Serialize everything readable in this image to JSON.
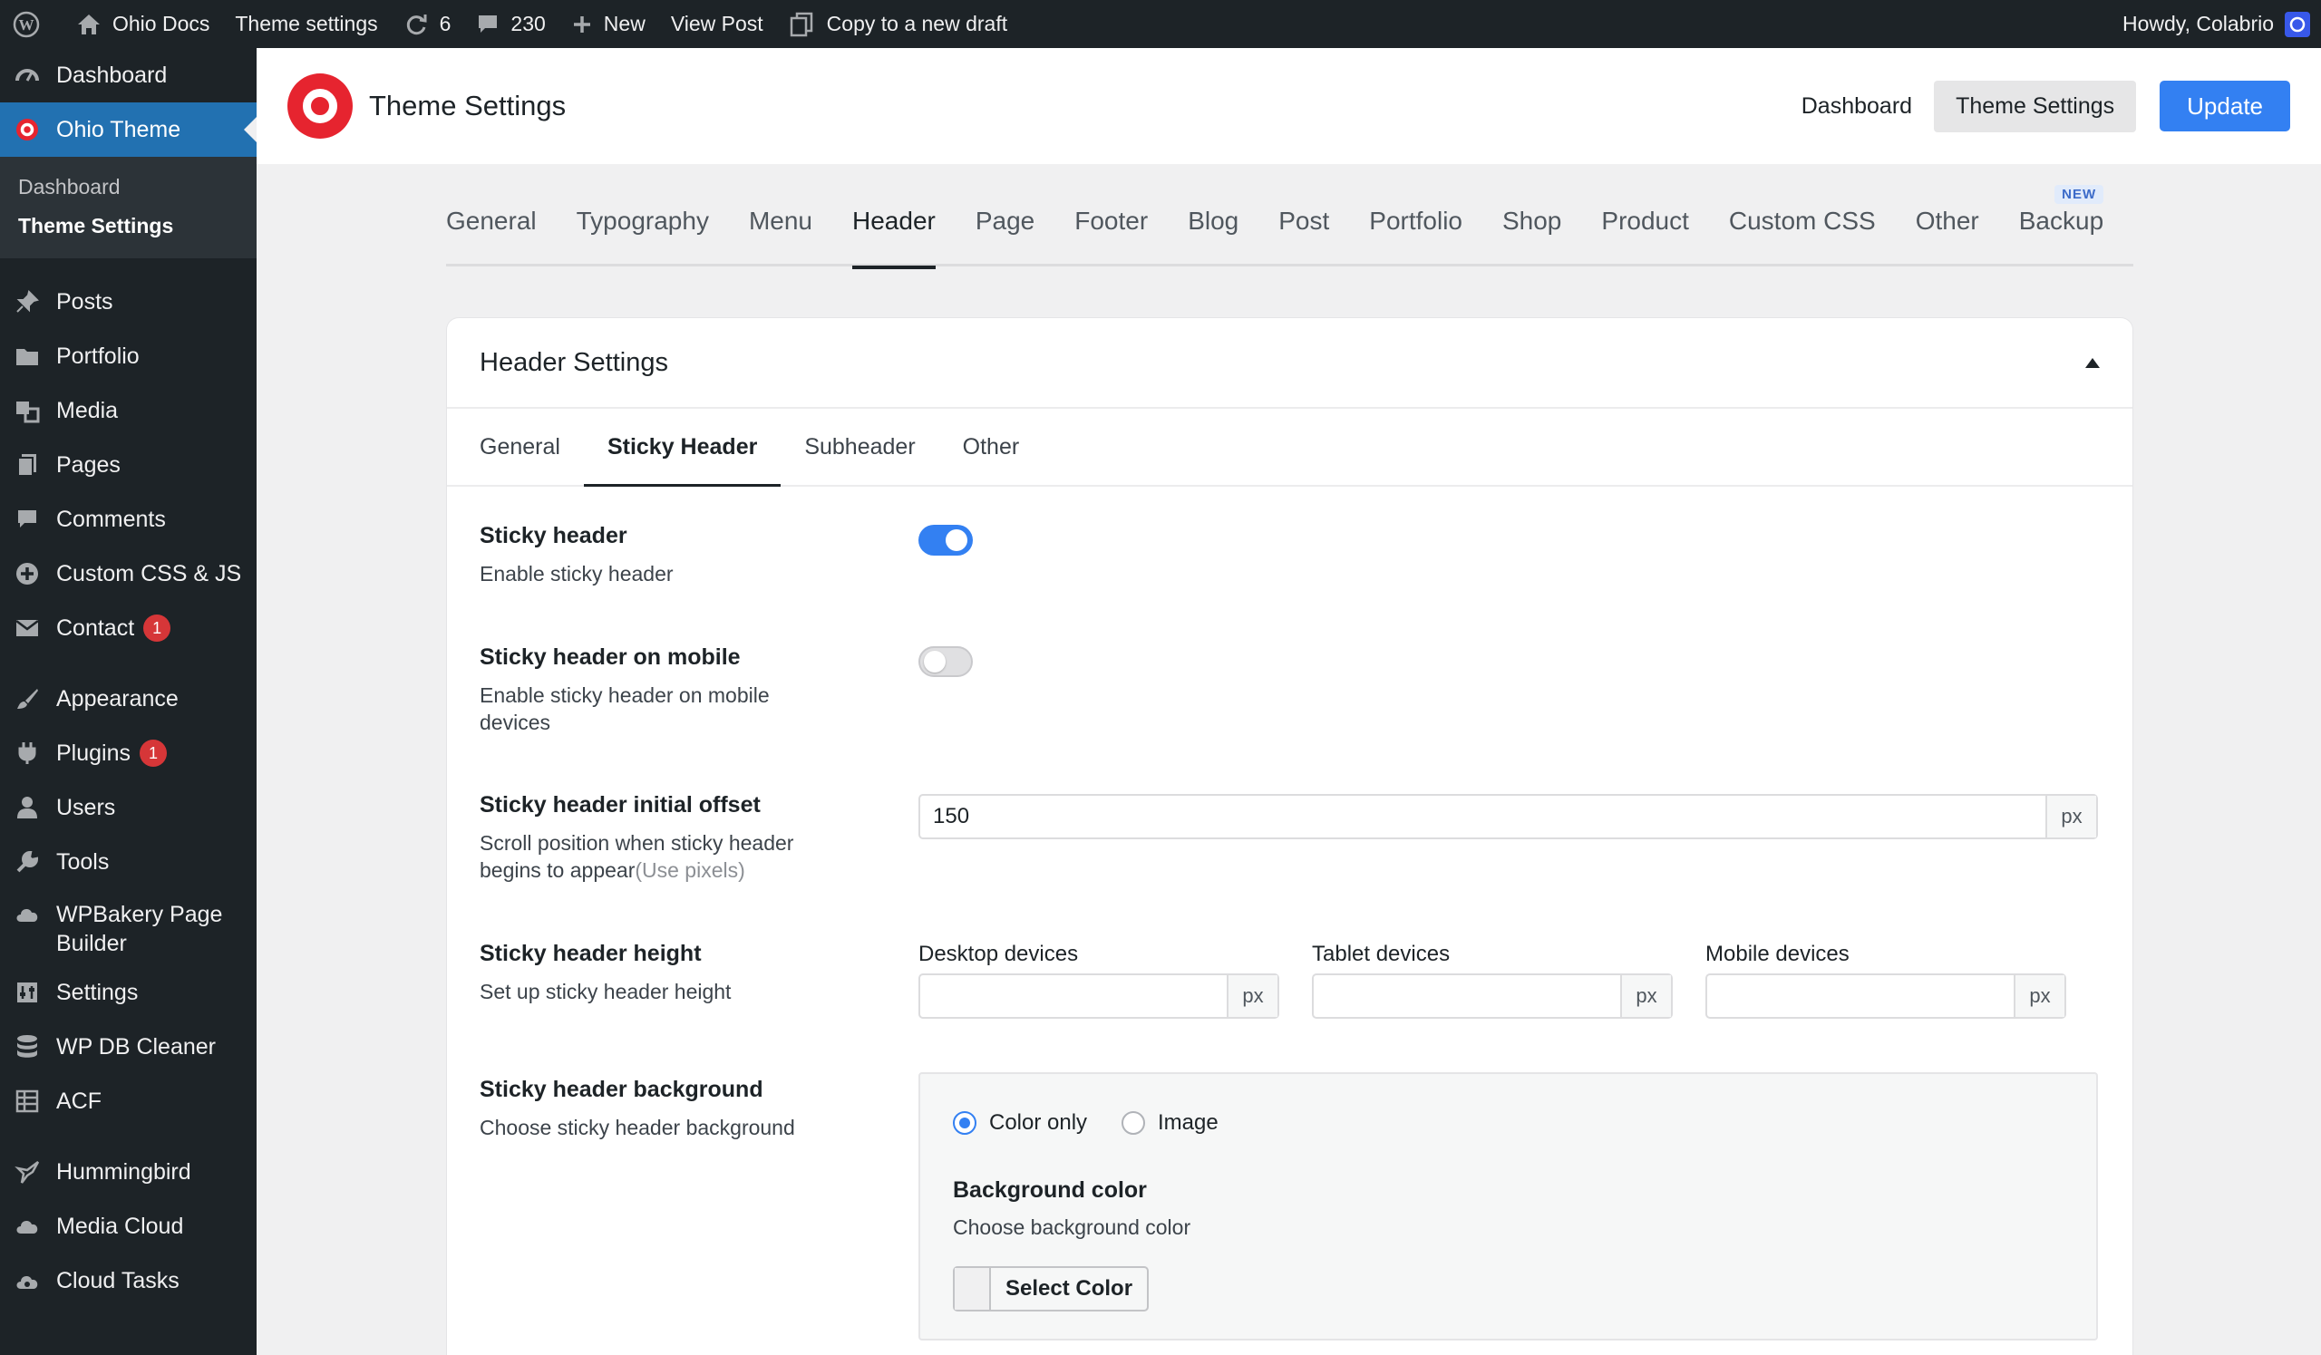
{
  "adminbar": {
    "site_name": "Ohio Docs",
    "theme_settings": "Theme settings",
    "updates_count": "6",
    "comments_count": "230",
    "new_label": "New",
    "view_post": "View Post",
    "copy_draft": "Copy to a new draft",
    "howdy": "Howdy, Colabrio"
  },
  "sidebar": {
    "dashboard": "Dashboard",
    "ohio_theme": "Ohio Theme",
    "submenu": [
      "Dashboard",
      "Theme Settings"
    ],
    "items": [
      {
        "label": "Posts",
        "icon": "pin-icon"
      },
      {
        "label": "Portfolio",
        "icon": "folder-icon"
      },
      {
        "label": "Media",
        "icon": "media-icon"
      },
      {
        "label": "Pages",
        "icon": "pages-icon"
      },
      {
        "label": "Comments",
        "icon": "comment-icon"
      },
      {
        "label": "Custom CSS & JS",
        "icon": "plus-circle-icon"
      },
      {
        "label": "Contact",
        "icon": "mail-icon",
        "badge": "1"
      },
      {
        "label": "Appearance",
        "icon": "brush-icon"
      },
      {
        "label": "Plugins",
        "icon": "plug-icon",
        "badge": "1"
      },
      {
        "label": "Users",
        "icon": "user-icon"
      },
      {
        "label": "Tools",
        "icon": "wrench-icon"
      },
      {
        "label": "WPBakery Page Builder",
        "icon": "cloud-icon"
      },
      {
        "label": "Settings",
        "icon": "settings-icon"
      },
      {
        "label": "WP DB Cleaner",
        "icon": "database-icon"
      },
      {
        "label": "ACF",
        "icon": "grid-icon"
      },
      {
        "label": "Hummingbird",
        "icon": "bird-icon"
      },
      {
        "label": "Media Cloud",
        "icon": "cloud-icon"
      },
      {
        "label": "Cloud Tasks",
        "icon": "gear-cloud-icon"
      }
    ]
  },
  "topbar": {
    "title": "Theme Settings",
    "dashboard": "Dashboard",
    "theme_settings": "Theme Settings",
    "update": "Update"
  },
  "tabs": [
    "General",
    "Typography",
    "Menu",
    "Header",
    "Page",
    "Footer",
    "Blog",
    "Post",
    "Portfolio",
    "Shop",
    "Product",
    "Custom CSS",
    "Other",
    "Backup"
  ],
  "active_tab": "Header",
  "new_badge": "NEW",
  "panel": {
    "title": "Header Settings",
    "subtabs": [
      "General",
      "Sticky Header",
      "Subheader",
      "Other"
    ],
    "sticky_header": {
      "label": "Sticky header",
      "desc": "Enable sticky header",
      "enabled": true
    },
    "sticky_mobile": {
      "label": "Sticky header on mobile",
      "desc": "Enable sticky header on mobile devices",
      "enabled": false
    },
    "offset": {
      "label": "Sticky header initial offset",
      "desc": "Scroll position when sticky header begins to appear",
      "desc_hint": "(Use pixels)",
      "value": "150",
      "unit": "px"
    },
    "height": {
      "label": "Sticky header height",
      "desc": "Set up sticky header height",
      "desktop": "Desktop devices",
      "tablet": "Tablet devices",
      "mobile": "Mobile devices",
      "unit": "px"
    },
    "background": {
      "label": "Sticky header background",
      "desc": "Choose sticky header background",
      "option_color": "Color only",
      "option_image": "Image",
      "selected": "Color only",
      "color_label": "Background color",
      "color_desc": "Choose background color",
      "select_color": "Select Color"
    }
  },
  "colors": {
    "accent": "#3380f2",
    "sidebar": "#1d2327",
    "active_menu": "#2271b1",
    "logo": "#e6242f",
    "badge": "#d63638"
  }
}
